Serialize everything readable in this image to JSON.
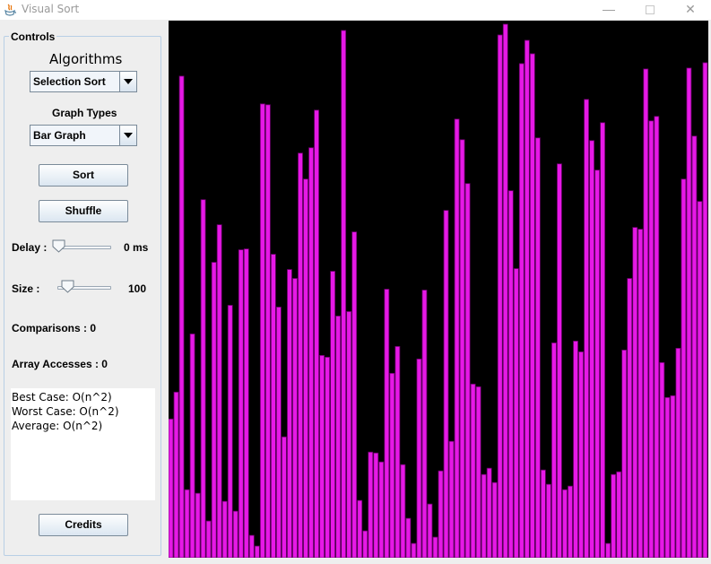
{
  "window": {
    "title": "Visual Sort",
    "controls": [
      "minimize",
      "maximize",
      "close"
    ],
    "close_glyph": "✕",
    "minimize_glyph": "—"
  },
  "controls_panel": {
    "title": "Controls",
    "algorithms_label": "Algorithms",
    "algorithm_selected": "Selection Sort",
    "graph_types_label": "Graph Types",
    "graph_type_selected": "Bar Graph",
    "sort_button": "Sort",
    "shuffle_button": "Shuffle",
    "delay_label": "Delay :",
    "delay_value": 0,
    "delay_value_text": "0 ms",
    "size_label": "Size :",
    "size_value": 100,
    "size_value_text": "100",
    "comparisons_text": "Comparisons : 0",
    "array_accesses_text": "Array Accesses : 0",
    "complexity_lines": [
      "Best Case: O(n^2)",
      "Worst Case: O(n^2)",
      "Average: O(n^2)"
    ],
    "credits_button": "Credits"
  },
  "colors": {
    "bar": "#e619e6",
    "bar_edge": "#6b006b",
    "graph_background": "#000000"
  },
  "chart_data": {
    "type": "bar",
    "title": "",
    "xlabel": "",
    "ylabel": "",
    "ylim": [
      0,
      600
    ],
    "values": [
      155,
      185,
      538,
      76,
      250,
      72,
      400,
      41,
      330,
      372,
      63,
      282,
      52,
      344,
      345,
      25,
      13,
      507,
      506,
      339,
      280,
      135,
      322,
      312,
      452,
      423,
      458,
      500,
      226,
      224,
      320,
      270,
      589,
      275,
      364,
      64,
      30,
      118,
      117,
      107,
      300,
      206,
      236,
      104,
      44,
      16,
      222,
      299,
      60,
      23,
      97,
      388,
      130,
      490,
      467,
      418,
      194,
      191,
      93,
      100,
      84,
      584,
      596,
      410,
      323,
      552,
      578,
      563,
      469,
      98,
      82,
      240,
      440,
      76,
      80,
      242,
      230,
      512,
      466,
      433,
      486,
      16,
      93,
      96,
      232,
      312,
      369,
      367,
      546,
      488,
      493,
      218,
      179,
      181,
      234,
      423,
      547,
      471,
      398,
      553
    ]
  }
}
